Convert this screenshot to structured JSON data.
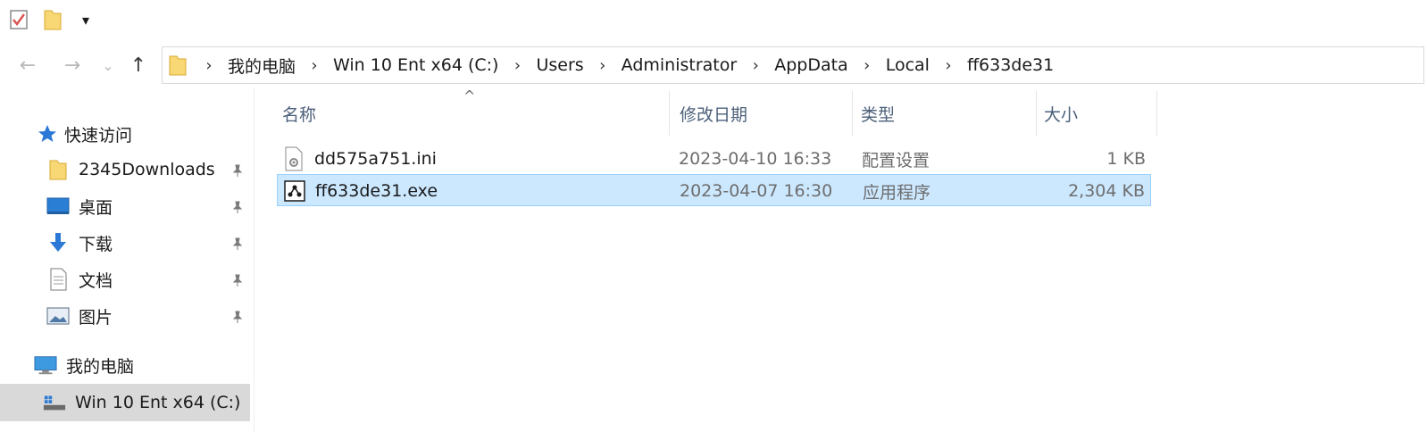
{
  "quick_access_toolbar": {
    "items": [
      {
        "icon": "properties-check-icon"
      },
      {
        "icon": "new-folder-icon"
      },
      {
        "icon": "customize-toolbar-dropdown-icon",
        "label": "▾"
      }
    ]
  },
  "navigation": {
    "back_icon": "←",
    "forward_icon": "→",
    "recent_icon": "⌄",
    "up_icon": "↑"
  },
  "address_bar": {
    "breadcrumbs": [
      "我的电脑",
      "Win 10 Ent x64 (C:)",
      "Users",
      "Administrator",
      "AppData",
      "Local",
      "ff633de31"
    ],
    "separator": "›"
  },
  "nav_pane": {
    "quick_access_label": "快速访问",
    "pinned": [
      {
        "label": "2345Downloads",
        "icon": "folder-icon"
      },
      {
        "label": "桌面",
        "icon": "desktop-icon"
      },
      {
        "label": "下载",
        "icon": "download-icon"
      },
      {
        "label": "文档",
        "icon": "documents-icon"
      },
      {
        "label": "图片",
        "icon": "pictures-icon"
      }
    ],
    "this_pc_label": "我的电脑",
    "drive_label": "Win 10 Ent x64 (C:)"
  },
  "file_list": {
    "sort_indicator": "^",
    "columns": [
      "名称",
      "修改日期",
      "类型",
      "大小"
    ],
    "rows": [
      {
        "name": "dd575a751.ini",
        "date": "2023-04-10 16:33",
        "type": "配置设置",
        "size": "1 KB",
        "icon": "ini-settings-file-icon",
        "selected": false
      },
      {
        "name": "ff633de31.exe",
        "date": "2023-04-07 16:30",
        "type": "应用程序",
        "size": "2,304 KB",
        "icon": "exe-application-icon",
        "selected": true
      }
    ]
  },
  "colors": {
    "selection_bg": "#cce8ff",
    "selection_border": "#99d1ff",
    "folder_yellow": "#f8d775",
    "header_text": "#4c607a",
    "drive_selected_bg": "#d9d9d9"
  }
}
